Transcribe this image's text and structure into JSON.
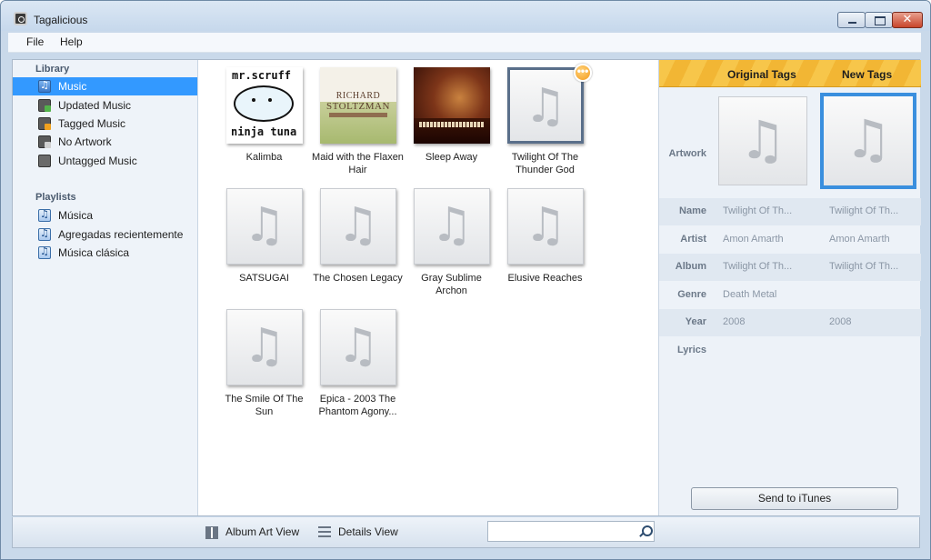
{
  "window": {
    "title": "Tagalicious"
  },
  "menu": [
    {
      "label": "File"
    },
    {
      "label": "Help"
    }
  ],
  "sidebar": {
    "library_heading": "Library",
    "library": [
      {
        "label": "Music",
        "icon": "music-library-icon",
        "selected": true
      },
      {
        "label": "Updated Music",
        "icon": "updated-music-icon"
      },
      {
        "label": "Tagged Music",
        "icon": "tagged-music-icon"
      },
      {
        "label": "No Artwork",
        "icon": "no-artwork-icon"
      },
      {
        "label": "Untagged Music",
        "icon": "untagged-music-icon"
      }
    ],
    "playlists_heading": "Playlists",
    "playlists": [
      {
        "label": "Música",
        "icon": "playlist-icon"
      },
      {
        "label": "Agregadas recientemente",
        "icon": "playlist-icon"
      },
      {
        "label": "Música clásica",
        "icon": "playlist-icon"
      }
    ]
  },
  "albums": [
    {
      "title": "Kalimba",
      "art_text": [
        "mr.scruff",
        "ninja tuna"
      ]
    },
    {
      "title": "Maid with the Flaxen Hair",
      "art_text": [
        "RICHARD",
        "STOLTZMAN"
      ]
    },
    {
      "title": "Sleep Away"
    },
    {
      "title": "Twilight Of The Thunder God",
      "selected": true,
      "badge": "•••"
    },
    {
      "title": "SATSUGAI"
    },
    {
      "title": "The Chosen Legacy"
    },
    {
      "title": "Gray Sublime Archon"
    },
    {
      "title": "Elusive Reaches"
    },
    {
      "title": "The Smile Of The Sun"
    },
    {
      "title": "Epica - 2003 The Phantom Agony..."
    }
  ],
  "tags": {
    "header_original": "Original Tags",
    "header_new": "New Tags",
    "artwork_label": "Artwork",
    "fields": [
      {
        "key": "Name",
        "original": "Twilight Of Th...",
        "new": "Twilight Of Th..."
      },
      {
        "key": "Artist",
        "original": "Amon Amarth",
        "new": "Amon Amarth"
      },
      {
        "key": "Album",
        "original": "Twilight Of Th...",
        "new": "Twilight Of Th..."
      },
      {
        "key": "Genre",
        "original": "Death Metal",
        "new": ""
      },
      {
        "key": "Year",
        "original": "2008",
        "new": "2008"
      },
      {
        "key": "Lyrics",
        "original": "",
        "new": ""
      }
    ],
    "send_button": "Send to iTunes"
  },
  "statusbar": {
    "album_art_view": "Album Art View",
    "details_view": "Details View",
    "search_value": ""
  },
  "colors": {
    "selection": "#3399ff",
    "accent_orange": "#f39a1a",
    "new_art_border": "#3a8fde"
  }
}
